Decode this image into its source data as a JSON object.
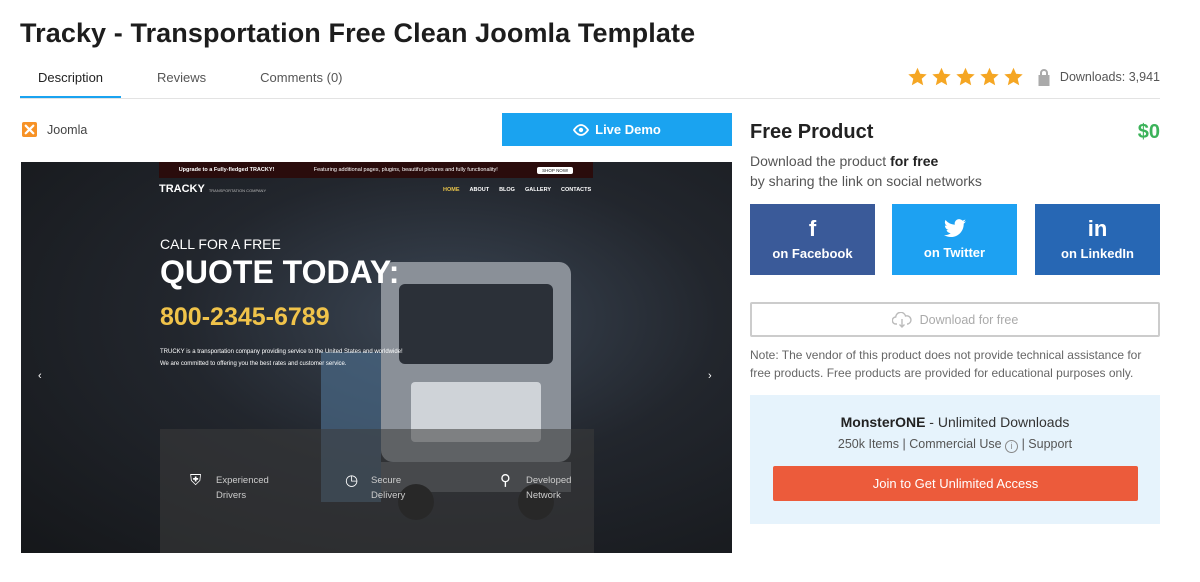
{
  "page": {
    "title": "Tracky - Transportation Free Clean Joomla Template"
  },
  "tabs": [
    {
      "label": "Description",
      "active": true
    },
    {
      "label": "Reviews",
      "active": false
    },
    {
      "label": "Comments (0)",
      "active": false
    }
  ],
  "rating": {
    "stars": 5,
    "max_stars": 5,
    "star_color": "#f5a623",
    "downloads": "Downloads: 3,941"
  },
  "platform": {
    "label": "Joomla",
    "icon": "joomla-icon"
  },
  "live_demo": {
    "label": "Live Demo",
    "icon": "eye-icon",
    "color": "#1aa3f0"
  },
  "preview": {
    "upgrade_text": "Upgrade to a Fully-fledged TRACKY!",
    "upgrade_detail": "Featuring additional pages, plugins, beautiful pictures and fully functionality!",
    "upgrade_button": "SHOP NOW!",
    "brand": "TRACKY",
    "brand_tagline": "TRANSPORTATION COMPANY",
    "nav": [
      "HOME",
      "ABOUT",
      "BLOG",
      "GALLERY",
      "CONTACTS"
    ],
    "hero_line1": "CALL FOR A FREE",
    "hero_line2": "QUOTE TODAY:",
    "phone": "800-2345-6789",
    "description_line1": "TRUCKY is a transportation company providing service to the United States and worldwide!",
    "description_line2": "We are committed to offering you the best rates and customer service.",
    "features": [
      {
        "line1": "Experienced",
        "line2": "Drivers",
        "icon": "truck-icon"
      },
      {
        "line1": "Secure",
        "line2": "Delivery",
        "icon": "clock-icon"
      },
      {
        "line1": "Developed",
        "line2": "Network",
        "icon": "map-pin-icon"
      }
    ]
  },
  "product": {
    "title": "Free Product",
    "price": "$0",
    "price_color": "#3cb35a",
    "sub_prefix": "Download the product ",
    "sub_bold": "for free",
    "sub_line2": "by sharing the link on social networks"
  },
  "share": {
    "facebook": {
      "label": "on Facebook",
      "icon": "f",
      "color": "#3a5a99"
    },
    "twitter": {
      "label": "on Twitter",
      "icon": "twitter-bird",
      "color": "#1da1f2"
    },
    "linkedin": {
      "label": "on LinkedIn",
      "icon": "in",
      "color": "#2767b4"
    }
  },
  "download_free": {
    "label": "Download for free",
    "icon": "cloud-download-icon"
  },
  "note": "Note: The vendor of this product does not provide technical assistance for free products. Free products are provided for educational purposes only.",
  "monsterone": {
    "brand": "MonsterONE",
    "title_suffix": " - Unlimited Downloads",
    "sub_prefix": "250k Items | Commercial Use ",
    "sub_suffix": " | Support",
    "button": "Join to Get Unlimited Access",
    "button_color": "#ec5b3b"
  }
}
